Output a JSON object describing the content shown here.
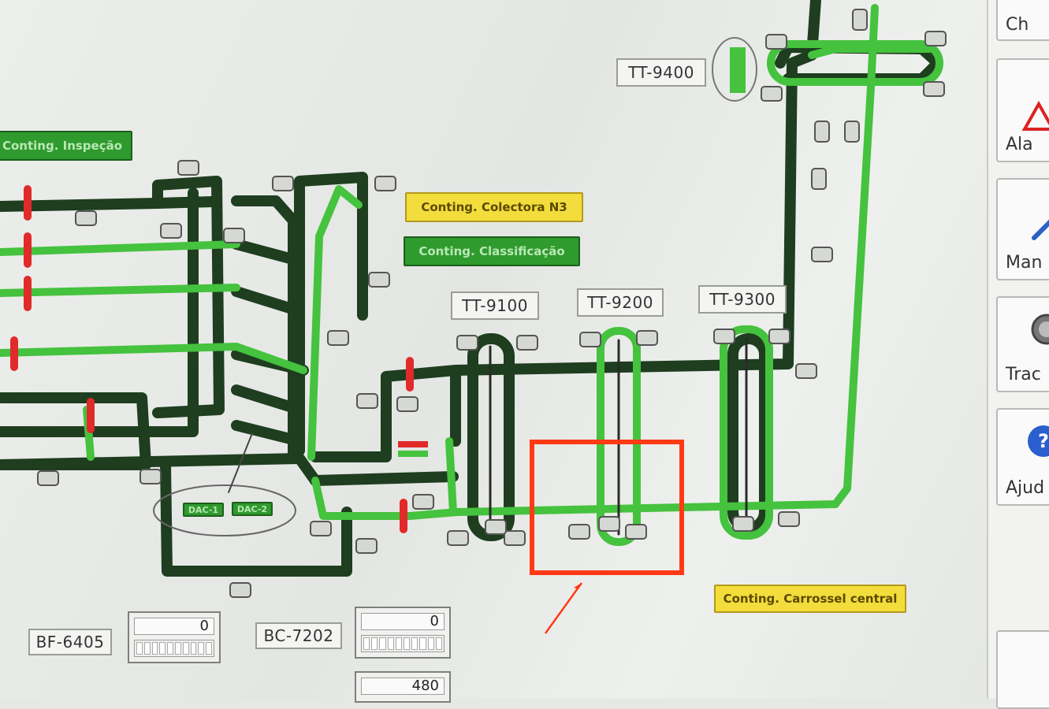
{
  "window": {
    "title": ""
  },
  "tags": {
    "tt9400": "TT-9400",
    "tt9100": "TT-9100",
    "tt9200": "TT-9200",
    "tt9300": "TT-9300",
    "bf6405": "BF-6405",
    "bc7202": "BC-7202",
    "dac1": "DAC-1",
    "dac2": "DAC-2"
  },
  "buttons": {
    "inspecao": "Conting. Inspeção",
    "colectora": "Conting. Colectora N3",
    "classificacao": "Conting. Classificação",
    "carrossel": "Conting. Carrossel central"
  },
  "counters": {
    "bf6405": "0",
    "bc7202": "0",
    "lower": "480"
  },
  "sidebar": {
    "items": [
      {
        "label": "Ch",
        "icon": "chart-icon"
      },
      {
        "label": "Ala",
        "icon": "alarm-icon"
      },
      {
        "label": "Man",
        "icon": "manual-icon"
      },
      {
        "label": "Trac",
        "icon": "tracking-icon"
      },
      {
        "label": "Ajud",
        "icon": "help-icon"
      }
    ]
  },
  "colors": {
    "active_conveyor": "#45c23e",
    "idle_conveyor": "#1e3e1f",
    "highlight": "#ff3a14",
    "fault": "#e12a2a"
  }
}
